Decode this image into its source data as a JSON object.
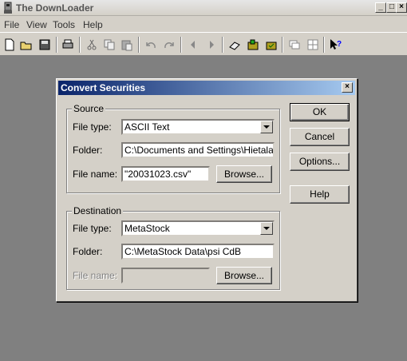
{
  "window": {
    "title": "The DownLoader",
    "minimize": "_",
    "maximize": "□",
    "close": "×"
  },
  "menu": [
    "File",
    "View",
    "Tools",
    "Help"
  ],
  "toolbar": {
    "icons": [
      "new-icon",
      "open-icon",
      "save-icon",
      "print-icon",
      "cut-icon",
      "copy-icon",
      "paste-icon",
      "undo-icon",
      "redo-icon",
      "back-icon",
      "forward-icon",
      "eraser-icon",
      "folder-green-icon",
      "folder-check-icon",
      "window-icon",
      "grid-icon",
      "help-pointer-icon"
    ]
  },
  "dialog": {
    "title": "Convert Securities",
    "close": "×",
    "source": {
      "legend": "Source",
      "file_type_label": "File type:",
      "file_type_value": "ASCII Text",
      "folder_label": "Folder:",
      "folder_value": "C:\\Documents and Settings\\Hietalam\\D",
      "file_name_label": "File name:",
      "file_name_value": "\"20031023.csv\"",
      "browse": "Browse..."
    },
    "destination": {
      "legend": "Destination",
      "file_type_label": "File type:",
      "file_type_value": "MetaStock",
      "folder_label": "Folder:",
      "folder_value": "C:\\MetaStock Data\\psi CdB",
      "file_name_label": "File name:",
      "file_name_value": "",
      "browse": "Browse..."
    },
    "buttons": {
      "ok": "OK",
      "cancel": "Cancel",
      "options": "Options...",
      "help": "Help"
    }
  }
}
